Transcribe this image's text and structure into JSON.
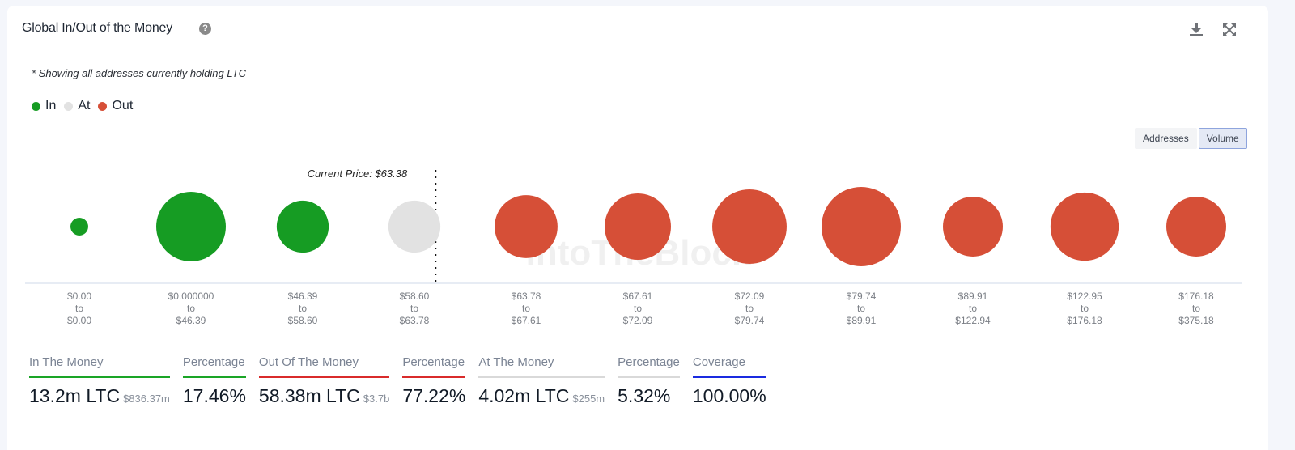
{
  "header": {
    "title": "Global In/Out of the Money",
    "help_icon": "question-circle-icon",
    "download_icon": "download-icon",
    "expand_icon": "expand-arrows-icon"
  },
  "note": "* Showing all addresses currently holding LTC",
  "legend": [
    {
      "label": "In",
      "color": "#169c23"
    },
    {
      "label": "At",
      "color": "#e2e2e2"
    },
    {
      "label": "Out",
      "color": "#d64f37"
    }
  ],
  "toggle": {
    "options": [
      "Addresses",
      "Volume"
    ],
    "selected": "Volume"
  },
  "watermark": "IntoTheBlock",
  "chart_data": {
    "type": "bubble",
    "title": "Global In/Out of the Money",
    "size_metric": "Volume",
    "current_price_label": "Current Price: $63.38",
    "current_price": 63.38,
    "clusters": [
      {
        "from": "$0.00",
        "to": "$0.00",
        "status": "In",
        "relative_volume": 0.05
      },
      {
        "from": "$0.000000",
        "to": "$46.39",
        "status": "In",
        "relative_volume": 0.77
      },
      {
        "from": "$46.39",
        "to": "$58.60",
        "status": "In",
        "relative_volume": 0.43
      },
      {
        "from": "$58.60",
        "to": "$63.78",
        "status": "At",
        "relative_volume": 0.43
      },
      {
        "from": "$63.78",
        "to": "$67.61",
        "status": "Out",
        "relative_volume": 0.63
      },
      {
        "from": "$67.61",
        "to": "$72.09",
        "status": "Out",
        "relative_volume": 0.7
      },
      {
        "from": "$72.09",
        "to": "$79.74",
        "status": "Out",
        "relative_volume": 0.88
      },
      {
        "from": "$79.74",
        "to": "$89.91",
        "status": "Out",
        "relative_volume": 1.0
      },
      {
        "from": "$89.91",
        "to": "$122.94",
        "status": "Out",
        "relative_volume": 0.57
      },
      {
        "from": "$122.95",
        "to": "$176.18",
        "status": "Out",
        "relative_volume": 0.74
      },
      {
        "from": "$176.18",
        "to": "$375.18",
        "status": "Out",
        "relative_volume": 0.57
      }
    ],
    "range_joiner": "to",
    "current_price_after_cluster_index": 3,
    "colors": {
      "In": "#169c23",
      "At": "#e2e2e2",
      "Out": "#d64f37"
    }
  },
  "stats": [
    {
      "label": "In The Money",
      "value": "13.2m LTC",
      "sub": "$836.37m",
      "color": "#1aa526"
    },
    {
      "label": "Percentage",
      "value": "17.46%",
      "sub": "",
      "color": "#1aa526"
    },
    {
      "label": "Out Of The Money",
      "value": "58.38m LTC",
      "sub": "$3.7b",
      "color": "#d92b2b"
    },
    {
      "label": "Percentage",
      "value": "77.22%",
      "sub": "",
      "color": "#d92b2b"
    },
    {
      "label": "At The Money",
      "value": "4.02m LTC",
      "sub": "$255m",
      "color": "#d9d9d9"
    },
    {
      "label": "Percentage",
      "value": "5.32%",
      "sub": "",
      "color": "#d9d9d9"
    },
    {
      "label": "Coverage",
      "value": "100.00%",
      "sub": "",
      "color": "#1a2be0"
    }
  ]
}
